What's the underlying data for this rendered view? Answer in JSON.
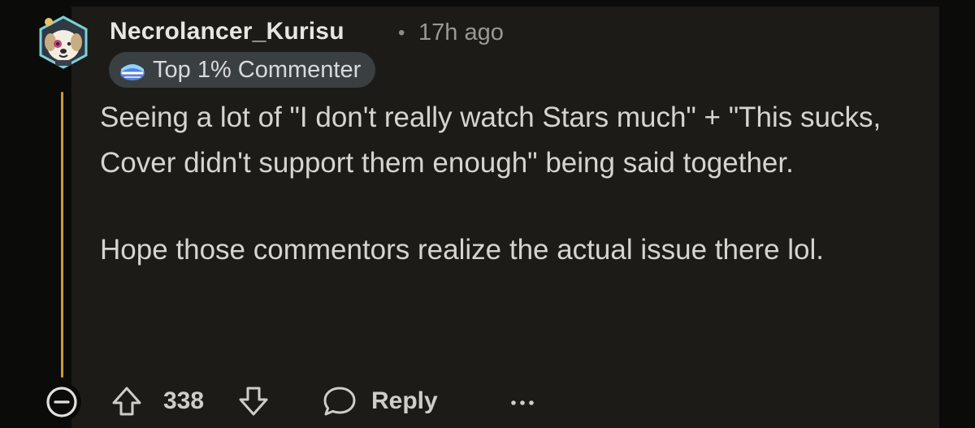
{
  "comment": {
    "username": "Necrolancer_Kurisu",
    "separator": "•",
    "time_ago": "17h ago",
    "badge": {
      "icon": "top-commenter-icon",
      "label": "Top 1% Commenter"
    },
    "paragraphs": [
      "Seeing a lot of \"I don't really watch Stars much\" + \"This sucks, Cover didn't support them enough\" being said together.",
      "Hope those commentors realize the actual issue there lol."
    ],
    "actions": {
      "collapse_icon": "minus-circle-icon",
      "upvote_icon": "upvote-arrow-icon",
      "vote_count": "338",
      "downvote_icon": "downvote-arrow-icon",
      "reply_icon": "chat-bubble-icon",
      "reply_label": "Reply",
      "more_icon": "ellipsis-icon"
    }
  },
  "colors": {
    "background": "#0b0b0a",
    "panel": "#1d1b17",
    "thread_line": "#c99a3b",
    "badge_bg": "#3a3f42",
    "text": "#d6d4d0",
    "muted": "#9a9894"
  }
}
